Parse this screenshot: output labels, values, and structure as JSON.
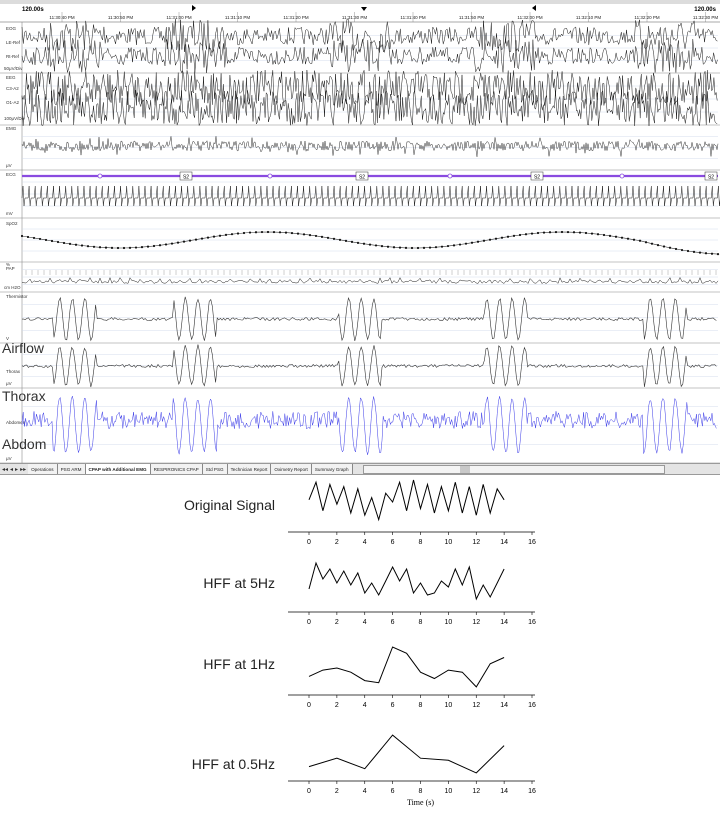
{
  "psg": {
    "scale_left": "120.00s",
    "scale_right": "120.00s",
    "times": [
      "11:30:40 PM",
      "11:30:50 PM",
      "11:31:00 PM",
      "11:31:10 PM",
      "11:31:20 PM",
      "11:31:30 PM",
      "11:31:40 PM",
      "11:31:50 PM",
      "11:32:00 PM",
      "11:32:10 PM",
      "11:32:20 PM",
      "11:32:30 PM"
    ],
    "channel_labels": [
      "EOG",
      "LE-Ref",
      "Rt-Ref",
      "EEG",
      "C3-A2",
      "O1-A2",
      "EMG",
      "ECG",
      "SpO2",
      "PAP",
      "Thermistor",
      "Thorax",
      "Abdomen"
    ],
    "units": [
      "50μV/Div",
      "100μV/Div",
      "μV",
      "mV",
      "%",
      "cm H2O",
      "V",
      "μV",
      "μV"
    ],
    "stage_labels": [
      "S2",
      "S2",
      "S2",
      "S2"
    ],
    "tabs": [
      "Operations",
      "PSG ARM",
      "CPAP with Additional EMG",
      "RESPIRONICS CPAP",
      "Std PSG",
      "Technician Report",
      "Oximetry Report",
      "Summary Graph"
    ],
    "overlay_labels": {
      "airflow": "Airflow",
      "thorax": "Thorax",
      "abdom": "Abdom"
    },
    "colors": {
      "trace": "#1a1a1a",
      "abdomen": "#3a3ae8",
      "stage_bar": "#8a4be0",
      "grid": "#c9d6ea"
    }
  },
  "chart_data": [
    {
      "type": "line",
      "title": "Original Signal",
      "x": [
        0,
        0.5,
        1,
        1.5,
        2,
        2.5,
        3,
        3.5,
        4,
        4.5,
        5,
        5.5,
        6,
        6.5,
        7,
        7.5,
        8,
        8.5,
        9,
        9.5,
        10,
        10.5,
        11,
        11.5,
        12,
        12.5,
        13,
        13.5,
        14
      ],
      "values": [
        0.55,
        0.95,
        0.3,
        0.9,
        0.45,
        0.85,
        0.25,
        0.8,
        0.2,
        0.6,
        0.1,
        0.7,
        0.5,
        0.95,
        0.3,
        1.0,
        0.35,
        0.9,
        0.25,
        0.85,
        0.3,
        0.95,
        0.25,
        0.85,
        0.2,
        0.9,
        0.25,
        0.8,
        0.55
      ],
      "xticks": [
        "0",
        "2",
        "4",
        "6",
        "8",
        "10",
        "12",
        "14",
        "16"
      ],
      "xlim": [
        0,
        16
      ]
    },
    {
      "type": "line",
      "title": "HFF at 5Hz",
      "x": [
        0,
        0.5,
        1,
        1.5,
        2,
        2.5,
        3,
        3.5,
        4,
        4.5,
        5,
        5.5,
        6,
        6.5,
        7,
        7.5,
        8,
        8.5,
        9,
        9.5,
        10,
        10.5,
        11,
        11.5,
        12,
        12.5,
        13,
        13.5,
        14
      ],
      "values": [
        0.3,
        0.95,
        0.55,
        0.8,
        0.45,
        0.75,
        0.4,
        0.7,
        0.2,
        0.45,
        0.15,
        0.5,
        0.85,
        0.5,
        0.8,
        0.2,
        0.45,
        0.15,
        0.2,
        0.5,
        0.35,
        0.8,
        0.4,
        0.85,
        0.05,
        0.4,
        0.1,
        0.45,
        0.8
      ],
      "xticks": [
        "0",
        "2",
        "4",
        "6",
        "8",
        "10",
        "12",
        "14",
        "16"
      ],
      "xlim": [
        0,
        16
      ]
    },
    {
      "type": "line",
      "title": "HFF at 1Hz",
      "x": [
        0,
        1,
        2,
        3,
        4,
        5,
        6,
        7,
        8,
        9,
        10,
        11,
        12,
        13,
        14
      ],
      "values": [
        0.3,
        0.45,
        0.5,
        0.4,
        0.2,
        0.15,
        1.0,
        0.85,
        0.4,
        0.25,
        0.45,
        0.4,
        0.05,
        0.6,
        0.75
      ],
      "xticks": [
        "0",
        "2",
        "4",
        "6",
        "8",
        "10",
        "12",
        "14",
        "16"
      ],
      "xlim": [
        0,
        16
      ]
    },
    {
      "type": "line",
      "title": "HFF at 0.5Hz",
      "x": [
        0,
        2,
        4,
        6,
        8,
        10,
        12,
        14
      ],
      "values": [
        0.2,
        0.4,
        0.15,
        0.95,
        0.4,
        0.35,
        0.05,
        0.7
      ],
      "xticks": [
        "0",
        "2",
        "4",
        "6",
        "8",
        "10",
        "12",
        "14",
        "16"
      ],
      "xlim": [
        0,
        16
      ],
      "xlabel": "Time (s)"
    }
  ]
}
